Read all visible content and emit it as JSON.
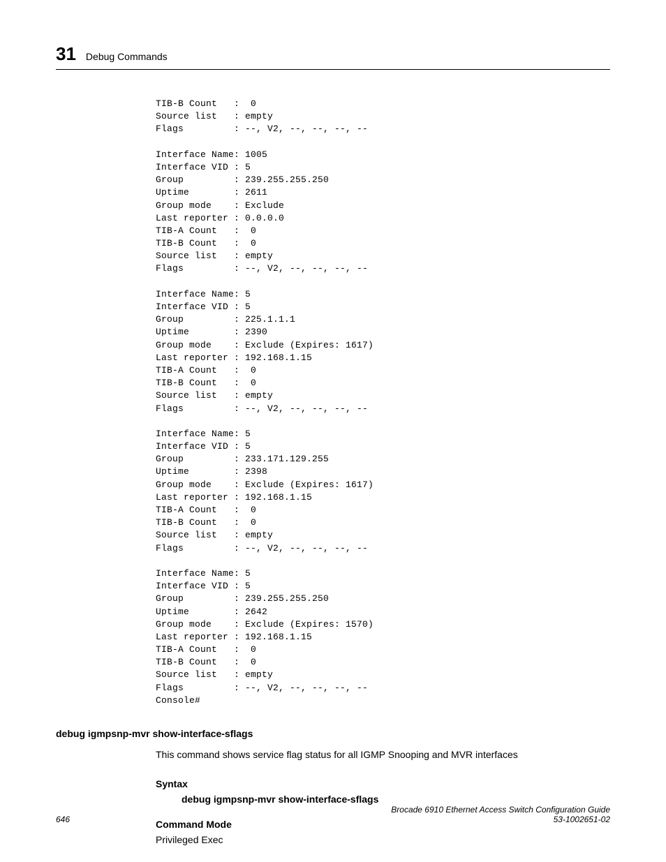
{
  "header": {
    "chapter_number": "31",
    "chapter_title": "Debug Commands"
  },
  "code_output": "TIB-B Count   :  0\nSource list   : empty\nFlags         : --, V2, --, --, --, --\n\nInterface Name: 1005\nInterface VID : 5\nGroup         : 239.255.255.250\nUptime        : 2611\nGroup mode    : Exclude\nLast reporter : 0.0.0.0\nTIB-A Count   :  0\nTIB-B Count   :  0\nSource list   : empty\nFlags         : --, V2, --, --, --, --\n\nInterface Name: 5\nInterface VID : 5\nGroup         : 225.1.1.1\nUptime        : 2390\nGroup mode    : Exclude (Expires: 1617)\nLast reporter : 192.168.1.15\nTIB-A Count   :  0\nTIB-B Count   :  0\nSource list   : empty\nFlags         : --, V2, --, --, --, --\n\nInterface Name: 5\nInterface VID : 5\nGroup         : 233.171.129.255\nUptime        : 2398\nGroup mode    : Exclude (Expires: 1617)\nLast reporter : 192.168.1.15\nTIB-A Count   :  0\nTIB-B Count   :  0\nSource list   : empty\nFlags         : --, V2, --, --, --, --\n\nInterface Name: 5\nInterface VID : 5\nGroup         : 239.255.255.250\nUptime        : 2642\nGroup mode    : Exclude (Expires: 1570)\nLast reporter : 192.168.1.15\nTIB-A Count   :  0\nTIB-B Count   :  0\nSource list   : empty\nFlags         : --, V2, --, --, --, --\nConsole#",
  "command": {
    "heading": "debug igmpsnp-mvr show-interface-sflags",
    "description": "This command shows service flag status for all IGMP Snooping and MVR interfaces",
    "syntax_label": "Syntax",
    "syntax_value": "debug igmpsnp-mvr show-interface-sflags",
    "mode_label": "Command Mode",
    "mode_value": "Privileged Exec"
  },
  "footer": {
    "page_number": "646",
    "guide_title": "Brocade 6910 Ethernet Access Switch Configuration Guide",
    "doc_number": "53-1002651-02"
  }
}
